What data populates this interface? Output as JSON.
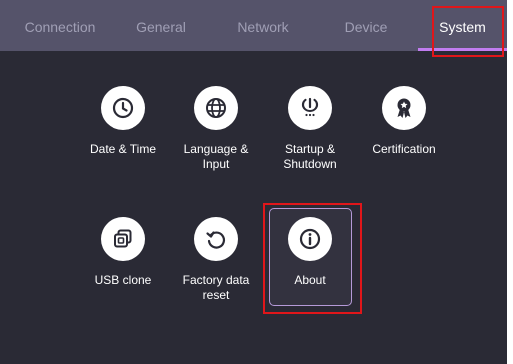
{
  "tabs": [
    {
      "label": "Connection",
      "active": false
    },
    {
      "label": "General",
      "active": false
    },
    {
      "label": "Network",
      "active": false
    },
    {
      "label": "Device",
      "active": false
    },
    {
      "label": "System",
      "active": true
    }
  ],
  "items": [
    {
      "label": "Date & Time",
      "icon": "clock-icon"
    },
    {
      "label": "Language &\nInput",
      "icon": "globe-icon"
    },
    {
      "label": "Startup &\nShutdown",
      "icon": "power-icon"
    },
    {
      "label": "Certification",
      "icon": "award-icon"
    },
    {
      "label": "USB clone",
      "icon": "usb-clone-icon"
    },
    {
      "label": "Factory data\nreset",
      "icon": "reset-icon"
    },
    {
      "label": "About",
      "icon": "info-icon",
      "selected": true
    }
  ],
  "colors": {
    "background": "#2a2a35",
    "tabbar": "#55536a",
    "tab_text": "#a09fb5",
    "accent": "#c17cf0",
    "annotation_red": "#e0161a",
    "icon_circle": "#ffffff"
  }
}
